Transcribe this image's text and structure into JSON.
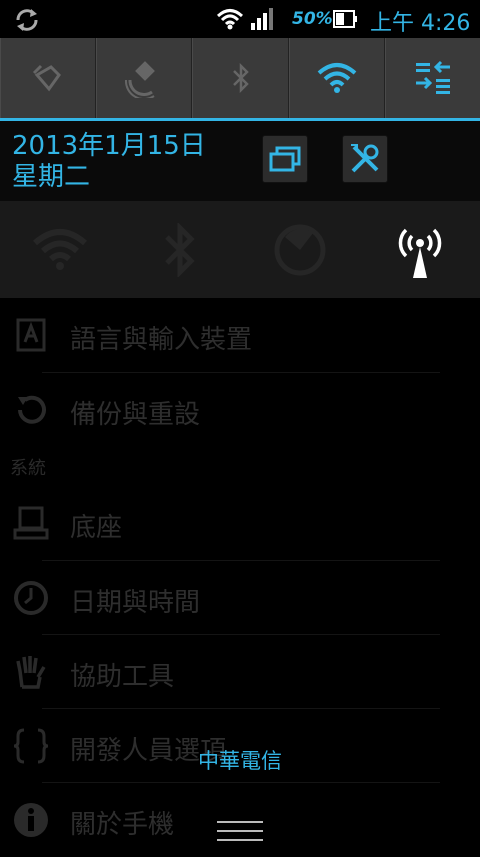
{
  "status_bar": {
    "battery_percent": "50%",
    "time": "上午 4:26",
    "icons": [
      "sync-icon",
      "wifi-icon",
      "signal-icon",
      "battery-icon"
    ]
  },
  "quick_toggles": [
    {
      "name": "flashlight",
      "icon": "flashlight-icon",
      "active": false
    },
    {
      "name": "gps",
      "icon": "gps-icon",
      "active": false
    },
    {
      "name": "bluetooth",
      "icon": "bluetooth-icon",
      "active": false
    },
    {
      "name": "wifi",
      "icon": "wifi-icon",
      "active": true
    },
    {
      "name": "data",
      "icon": "data-transfer-icon",
      "active": true
    }
  ],
  "date": {
    "line1": "2013年1月15日",
    "line2": "星期二"
  },
  "secondary_toggles": [
    {
      "icon": "wifi-icon",
      "active": false
    },
    {
      "icon": "bluetooth-icon",
      "active": false
    },
    {
      "icon": "data-usage-icon",
      "active": false
    },
    {
      "icon": "hotspot-icon",
      "active": true
    }
  ],
  "settings": {
    "items": [
      {
        "label": "語言與輸入裝置",
        "icon": "language-icon"
      },
      {
        "label": "備份與重設",
        "icon": "backup-icon"
      },
      {
        "label": "底座",
        "icon": "dock-icon"
      },
      {
        "label": "日期與時間",
        "icon": "clock-icon"
      },
      {
        "label": "協助工具",
        "icon": "accessibility-icon"
      },
      {
        "label": "開發人員選項",
        "icon": "developer-icon"
      },
      {
        "label": "關於手機",
        "icon": "info-icon"
      }
    ],
    "section_system": "系統"
  },
  "carrier": "中華電信",
  "colors": {
    "accent": "#33b5e5",
    "toggle_bg": "#3a3a3a"
  }
}
